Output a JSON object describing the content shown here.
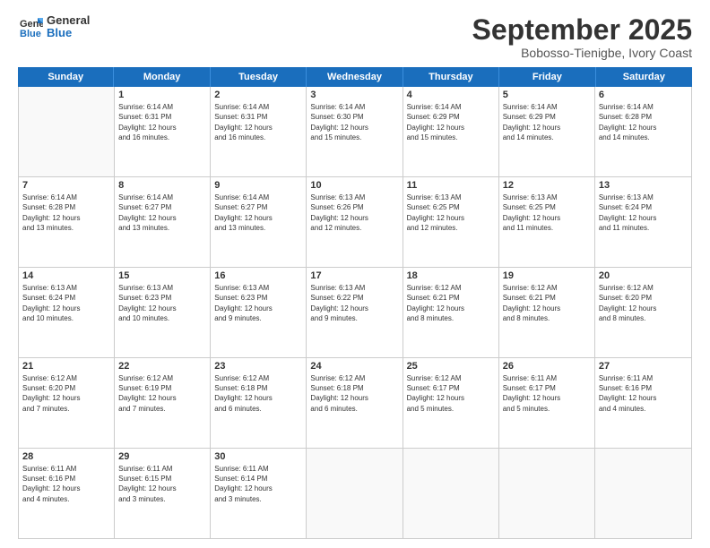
{
  "header": {
    "logo": {
      "line1": "General",
      "line2": "Blue"
    },
    "title": "September 2025",
    "location": "Bobosso-Tienigbe, Ivory Coast"
  },
  "weekdays": [
    "Sunday",
    "Monday",
    "Tuesday",
    "Wednesday",
    "Thursday",
    "Friday",
    "Saturday"
  ],
  "weeks": [
    [
      {
        "day": "",
        "info": ""
      },
      {
        "day": "1",
        "info": "Sunrise: 6:14 AM\nSunset: 6:31 PM\nDaylight: 12 hours\nand 16 minutes."
      },
      {
        "day": "2",
        "info": "Sunrise: 6:14 AM\nSunset: 6:31 PM\nDaylight: 12 hours\nand 16 minutes."
      },
      {
        "day": "3",
        "info": "Sunrise: 6:14 AM\nSunset: 6:30 PM\nDaylight: 12 hours\nand 15 minutes."
      },
      {
        "day": "4",
        "info": "Sunrise: 6:14 AM\nSunset: 6:29 PM\nDaylight: 12 hours\nand 15 minutes."
      },
      {
        "day": "5",
        "info": "Sunrise: 6:14 AM\nSunset: 6:29 PM\nDaylight: 12 hours\nand 14 minutes."
      },
      {
        "day": "6",
        "info": "Sunrise: 6:14 AM\nSunset: 6:28 PM\nDaylight: 12 hours\nand 14 minutes."
      }
    ],
    [
      {
        "day": "7",
        "info": "Sunrise: 6:14 AM\nSunset: 6:28 PM\nDaylight: 12 hours\nand 13 minutes."
      },
      {
        "day": "8",
        "info": "Sunrise: 6:14 AM\nSunset: 6:27 PM\nDaylight: 12 hours\nand 13 minutes."
      },
      {
        "day": "9",
        "info": "Sunrise: 6:14 AM\nSunset: 6:27 PM\nDaylight: 12 hours\nand 13 minutes."
      },
      {
        "day": "10",
        "info": "Sunrise: 6:13 AM\nSunset: 6:26 PM\nDaylight: 12 hours\nand 12 minutes."
      },
      {
        "day": "11",
        "info": "Sunrise: 6:13 AM\nSunset: 6:25 PM\nDaylight: 12 hours\nand 12 minutes."
      },
      {
        "day": "12",
        "info": "Sunrise: 6:13 AM\nSunset: 6:25 PM\nDaylight: 12 hours\nand 11 minutes."
      },
      {
        "day": "13",
        "info": "Sunrise: 6:13 AM\nSunset: 6:24 PM\nDaylight: 12 hours\nand 11 minutes."
      }
    ],
    [
      {
        "day": "14",
        "info": "Sunrise: 6:13 AM\nSunset: 6:24 PM\nDaylight: 12 hours\nand 10 minutes."
      },
      {
        "day": "15",
        "info": "Sunrise: 6:13 AM\nSunset: 6:23 PM\nDaylight: 12 hours\nand 10 minutes."
      },
      {
        "day": "16",
        "info": "Sunrise: 6:13 AM\nSunset: 6:23 PM\nDaylight: 12 hours\nand 9 minutes."
      },
      {
        "day": "17",
        "info": "Sunrise: 6:13 AM\nSunset: 6:22 PM\nDaylight: 12 hours\nand 9 minutes."
      },
      {
        "day": "18",
        "info": "Sunrise: 6:12 AM\nSunset: 6:21 PM\nDaylight: 12 hours\nand 8 minutes."
      },
      {
        "day": "19",
        "info": "Sunrise: 6:12 AM\nSunset: 6:21 PM\nDaylight: 12 hours\nand 8 minutes."
      },
      {
        "day": "20",
        "info": "Sunrise: 6:12 AM\nSunset: 6:20 PM\nDaylight: 12 hours\nand 8 minutes."
      }
    ],
    [
      {
        "day": "21",
        "info": "Sunrise: 6:12 AM\nSunset: 6:20 PM\nDaylight: 12 hours\nand 7 minutes."
      },
      {
        "day": "22",
        "info": "Sunrise: 6:12 AM\nSunset: 6:19 PM\nDaylight: 12 hours\nand 7 minutes."
      },
      {
        "day": "23",
        "info": "Sunrise: 6:12 AM\nSunset: 6:18 PM\nDaylight: 12 hours\nand 6 minutes."
      },
      {
        "day": "24",
        "info": "Sunrise: 6:12 AM\nSunset: 6:18 PM\nDaylight: 12 hours\nand 6 minutes."
      },
      {
        "day": "25",
        "info": "Sunrise: 6:12 AM\nSunset: 6:17 PM\nDaylight: 12 hours\nand 5 minutes."
      },
      {
        "day": "26",
        "info": "Sunrise: 6:11 AM\nSunset: 6:17 PM\nDaylight: 12 hours\nand 5 minutes."
      },
      {
        "day": "27",
        "info": "Sunrise: 6:11 AM\nSunset: 6:16 PM\nDaylight: 12 hours\nand 4 minutes."
      }
    ],
    [
      {
        "day": "28",
        "info": "Sunrise: 6:11 AM\nSunset: 6:16 PM\nDaylight: 12 hours\nand 4 minutes."
      },
      {
        "day": "29",
        "info": "Sunrise: 6:11 AM\nSunset: 6:15 PM\nDaylight: 12 hours\nand 3 minutes."
      },
      {
        "day": "30",
        "info": "Sunrise: 6:11 AM\nSunset: 6:14 PM\nDaylight: 12 hours\nand 3 minutes."
      },
      {
        "day": "",
        "info": ""
      },
      {
        "day": "",
        "info": ""
      },
      {
        "day": "",
        "info": ""
      },
      {
        "day": "",
        "info": ""
      }
    ]
  ]
}
